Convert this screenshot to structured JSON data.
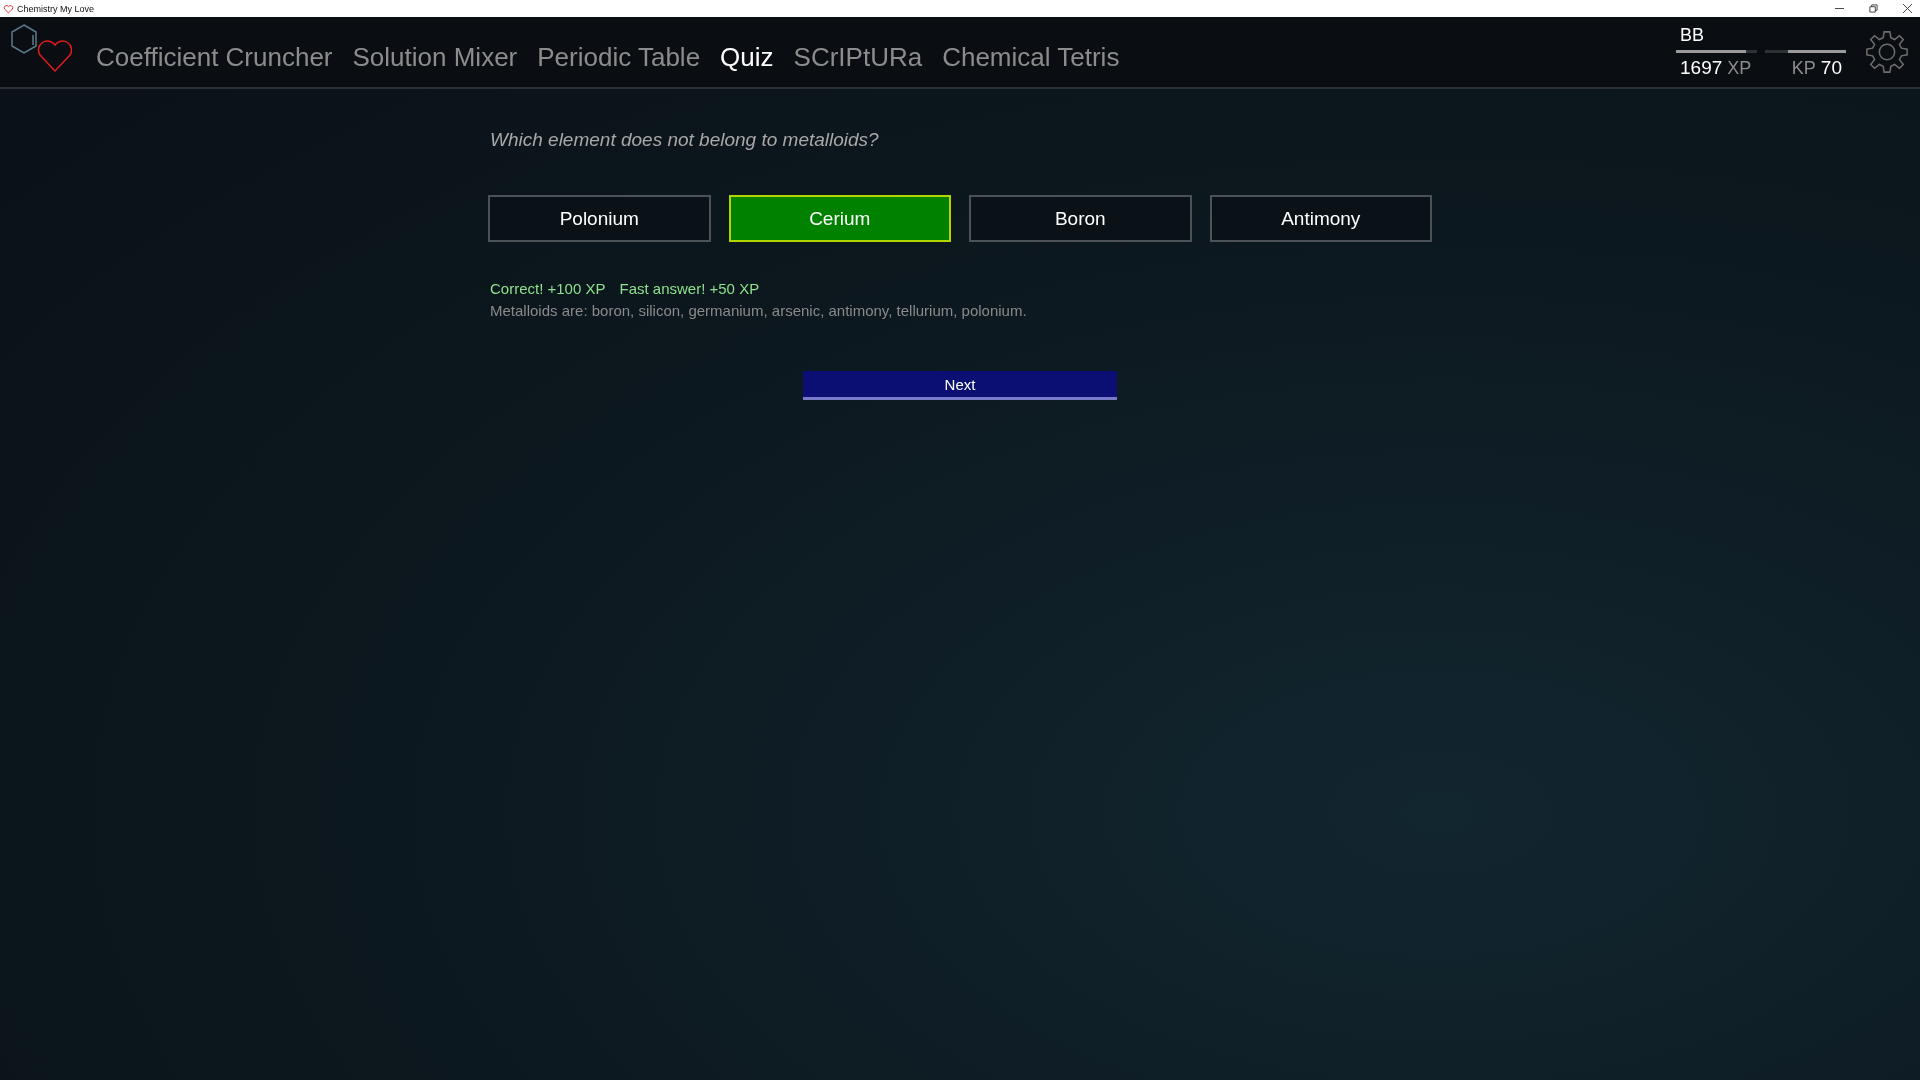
{
  "window": {
    "title": "Chemistry My Love"
  },
  "nav": {
    "tabs": [
      {
        "label": "Coefficient Cruncher",
        "selected": false
      },
      {
        "label": "Solution Mixer",
        "selected": false
      },
      {
        "label": "Periodic Table",
        "selected": false
      },
      {
        "label": "Quiz",
        "selected": true
      },
      {
        "label": "SCrIPtURa",
        "selected": false
      },
      {
        "label": "Chemical Tetris",
        "selected": false
      }
    ]
  },
  "player": {
    "name": "BB",
    "xp": {
      "value": "1697",
      "unit": "XP",
      "level": 0.86
    },
    "kp": {
      "unit": "KP",
      "value": "70",
      "level": 0.72
    }
  },
  "quiz": {
    "question": "Which element does not belong to metalloids?",
    "answers": [
      {
        "label": "Polonium",
        "selected": false
      },
      {
        "label": "Cerium",
        "selected": true
      },
      {
        "label": "Boron",
        "selected": false
      },
      {
        "label": "Antimony",
        "selected": false
      }
    ],
    "feedback": [
      "Correct! +100 XP",
      "Fast answer! +50 XP"
    ],
    "explanation": "Metalloids are: boron, silicon, germanium, arsenic, antimony, tellurium, polonium.",
    "next_button": "Next"
  }
}
